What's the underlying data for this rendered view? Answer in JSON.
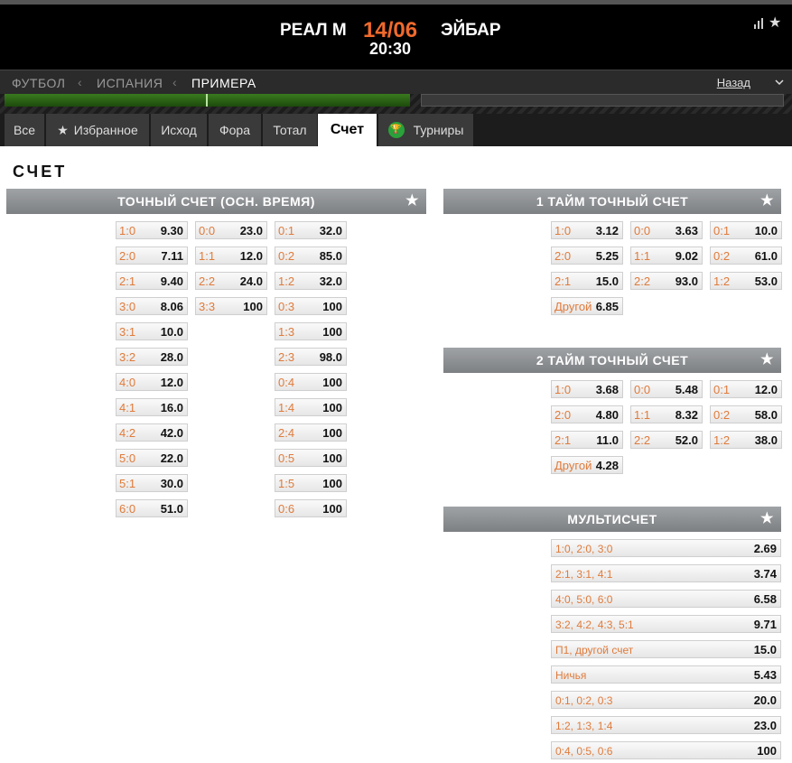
{
  "match": {
    "home": "РЕАЛ М",
    "away": "ЭЙБАР",
    "date": "14/06",
    "time": "20:30"
  },
  "breadcrumb": [
    "ФУТБОЛ",
    "ИСПАНИЯ",
    "ПРИМЕРА"
  ],
  "back_label": "Назад",
  "tabs": [
    "Все",
    "Избранное",
    "Исход",
    "Фора",
    "Тотал",
    "Счет",
    "Турниры"
  ],
  "section_title": "СЧЕТ",
  "accent_color": "#f06a2c",
  "exact_score": {
    "title": "ТОЧНЫЙ СЧЕТ (ОСН. ВРЕМЯ)",
    "col1": [
      [
        "1:0",
        "9.30"
      ],
      [
        "2:0",
        "7.11"
      ],
      [
        "2:1",
        "9.40"
      ],
      [
        "3:0",
        "8.06"
      ],
      [
        "3:1",
        "10.0"
      ],
      [
        "3:2",
        "28.0"
      ],
      [
        "4:0",
        "12.0"
      ],
      [
        "4:1",
        "16.0"
      ],
      [
        "4:2",
        "42.0"
      ],
      [
        "5:0",
        "22.0"
      ],
      [
        "5:1",
        "30.0"
      ],
      [
        "6:0",
        "51.0"
      ]
    ],
    "col2": [
      [
        "0:0",
        "23.0"
      ],
      [
        "1:1",
        "12.0"
      ],
      [
        "2:2",
        "24.0"
      ],
      [
        "3:3",
        "100"
      ]
    ],
    "col3": [
      [
        "0:1",
        "32.0"
      ],
      [
        "0:2",
        "85.0"
      ],
      [
        "1:2",
        "32.0"
      ],
      [
        "0:3",
        "100"
      ],
      [
        "1:3",
        "100"
      ],
      [
        "2:3",
        "98.0"
      ],
      [
        "0:4",
        "100"
      ],
      [
        "1:4",
        "100"
      ],
      [
        "2:4",
        "100"
      ],
      [
        "0:5",
        "100"
      ],
      [
        "1:5",
        "100"
      ],
      [
        "0:6",
        "100"
      ]
    ]
  },
  "half1": {
    "title": "1 ТАЙМ ТОЧНЫЙ СЧЕТ",
    "col1": [
      [
        "1:0",
        "3.12"
      ],
      [
        "2:0",
        "5.25"
      ],
      [
        "2:1",
        "15.0"
      ]
    ],
    "col2": [
      [
        "0:0",
        "3.63"
      ],
      [
        "1:1",
        "9.02"
      ],
      [
        "2:2",
        "93.0"
      ]
    ],
    "col3": [
      [
        "0:1",
        "10.0"
      ],
      [
        "0:2",
        "61.0"
      ],
      [
        "1:2",
        "53.0"
      ]
    ],
    "other": [
      "Другой",
      "6.85"
    ]
  },
  "half2": {
    "title": "2 ТАЙМ ТОЧНЫЙ СЧЕТ",
    "col1": [
      [
        "1:0",
        "3.68"
      ],
      [
        "2:0",
        "4.80"
      ],
      [
        "2:1",
        "11.0"
      ]
    ],
    "col2": [
      [
        "0:0",
        "5.48"
      ],
      [
        "1:1",
        "8.32"
      ],
      [
        "2:2",
        "52.0"
      ]
    ],
    "col3": [
      [
        "0:1",
        "12.0"
      ],
      [
        "0:2",
        "58.0"
      ],
      [
        "1:2",
        "38.0"
      ]
    ],
    "other": [
      "Другой",
      "4.28"
    ]
  },
  "multi": {
    "title": "МУЛЬТИСЧЕТ",
    "rows": [
      [
        "1:0, 2:0, 3:0",
        "2.69"
      ],
      [
        "2:1, 3:1, 4:1",
        "3.74"
      ],
      [
        "4:0, 5:0, 6:0",
        "6.58"
      ],
      [
        "3:2, 4:2, 4:3, 5:1",
        "9.71"
      ],
      [
        "П1, другой счет",
        "15.0"
      ],
      [
        "Ничья",
        "5.43"
      ],
      [
        "0:1, 0:2, 0:3",
        "20.0"
      ],
      [
        "1:2, 1:3, 1:4",
        "23.0"
      ],
      [
        "0:4, 0:5, 0:6",
        "100"
      ]
    ]
  }
}
